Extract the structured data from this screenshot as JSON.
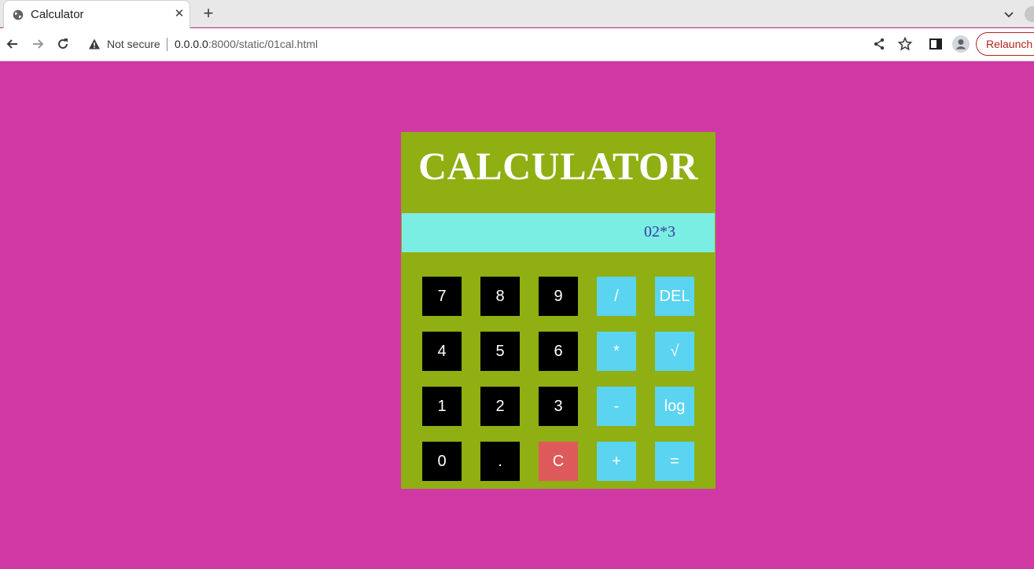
{
  "browser": {
    "tab_title": "Calculator",
    "tab_close": "✕",
    "new_tab": "+",
    "not_secure": "Not secure",
    "url_host": "0.0.0.0",
    "url_rest": ":8000/static/01cal.html",
    "relaunch": "Relaunch"
  },
  "calculator": {
    "title": "CALCULATOR",
    "display": "02*3",
    "colors": {
      "page_bg": "#d038a4",
      "panel_bg": "#8faf12",
      "display_bg": "#7aeee3",
      "number_key": "#000000",
      "operator_key": "#5ad4f0",
      "clear_key": "#de5a5a"
    },
    "keys": {
      "k7": "7",
      "k8": "8",
      "k9": "9",
      "div": "/",
      "del": "DEL",
      "k4": "4",
      "k5": "5",
      "k6": "6",
      "mul": "*",
      "sqrt": "√",
      "k1": "1",
      "k2": "2",
      "k3": "3",
      "sub": "-",
      "log": "log",
      "k0": "0",
      "dot": ".",
      "clear": "C",
      "add": "+",
      "eq": "="
    }
  }
}
